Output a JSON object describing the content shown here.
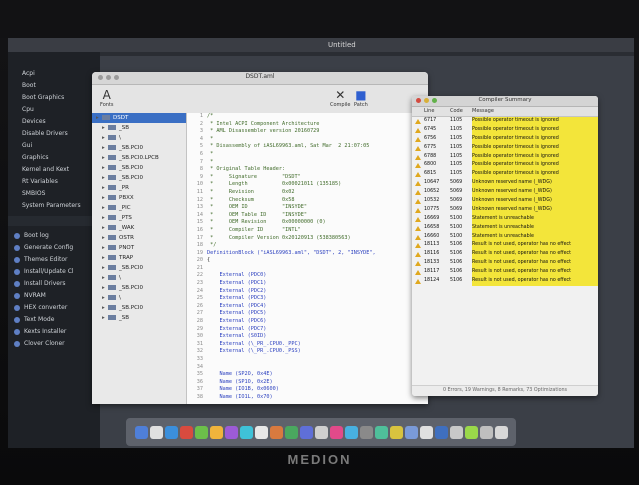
{
  "menubar": {
    "title": "Untitled"
  },
  "sidebar": {
    "items": [
      "Acpi",
      "Boot",
      "Boot Graphics",
      "Cpu",
      "Devices",
      "Disable Drivers",
      "Gui",
      "Graphics",
      "Kernel and Kext",
      "Rt Variables",
      "SMBIOS",
      "System Parameters"
    ],
    "tools": [
      "Boot log",
      "Generate Config",
      "Themes Editor",
      "Install/Update Cl",
      "Install Drivers",
      "NVRAM",
      "HEX converter",
      "Text Mode",
      "Kexts Installer",
      "Clover Cloner"
    ]
  },
  "main_window": {
    "title": "DSDT.aml",
    "toolbar": {
      "fonts_label": "Fonts",
      "compile_label": "Compile",
      "patch_label": "Patch"
    },
    "tree": [
      {
        "label": "DSDT",
        "selected": true
      },
      {
        "label": "_SB"
      },
      {
        "label": "\\"
      },
      {
        "label": "_SB.PCI0"
      },
      {
        "label": "_SB.PCI0.LPCB"
      },
      {
        "label": "_SB.PCI0"
      },
      {
        "label": "_SB.PCI0"
      },
      {
        "label": "_PR"
      },
      {
        "label": "PBXX"
      },
      {
        "label": "_PIC"
      },
      {
        "label": "_PTS"
      },
      {
        "label": "_WAK"
      },
      {
        "label": "OSTR"
      },
      {
        "label": "PNOT"
      },
      {
        "label": "TRAP"
      },
      {
        "label": "_SB.PCI0"
      },
      {
        "label": "\\"
      },
      {
        "label": "_SB.PCI0"
      },
      {
        "label": "\\"
      },
      {
        "label": "_SB.PCI0"
      },
      {
        "label": "_SB"
      }
    ],
    "code": [
      {
        "n": "1",
        "t": "/*"
      },
      {
        "n": "2",
        "t": " * Intel ACPI Component Architecture"
      },
      {
        "n": "3",
        "t": " * AML Disassembler version 20160729"
      },
      {
        "n": "4",
        "t": " *"
      },
      {
        "n": "5",
        "t": " * Disassembly of iASL69963.aml, Sat Mar  2 21:07:05"
      },
      {
        "n": "6",
        "t": " *"
      },
      {
        "n": "7",
        "t": " *"
      },
      {
        "n": "8",
        "t": " * Original Table Header:"
      },
      {
        "n": "9",
        "t": " *     Signature        \"DSDT\""
      },
      {
        "n": "10",
        "t": " *     Length           0x00021011 (135185)"
      },
      {
        "n": "11",
        "t": " *     Revision         0x02"
      },
      {
        "n": "12",
        "t": " *     Checksum         0x58"
      },
      {
        "n": "13",
        "t": " *     OEM ID           \"INSYDE\""
      },
      {
        "n": "14",
        "t": " *     OEM Table ID     \"INSYDE\""
      },
      {
        "n": "15",
        "t": " *     OEM Revision     0x00000000 (0)"
      },
      {
        "n": "16",
        "t": " *     Compiler ID      \"INTL\""
      },
      {
        "n": "17",
        "t": " *     Compiler Version 0x20120913 (538380563)"
      },
      {
        "n": "18",
        "t": " */"
      },
      {
        "n": "19",
        "t": "DefinitionBlock (\"iASL69963.aml\", \"DSDT\", 2, \"INSYDE\","
      },
      {
        "n": "20",
        "t": "{"
      },
      {
        "n": "21",
        "t": ""
      },
      {
        "n": "22",
        "t": "    External (PDC0)"
      },
      {
        "n": "23",
        "t": "    External (PDC1)"
      },
      {
        "n": "24",
        "t": "    External (PDC2)"
      },
      {
        "n": "25",
        "t": "    External (PDC3)"
      },
      {
        "n": "26",
        "t": "    External (PDC4)"
      },
      {
        "n": "27",
        "t": "    External (PDC5)"
      },
      {
        "n": "28",
        "t": "    External (PDC6)"
      },
      {
        "n": "29",
        "t": "    External (PDC7)"
      },
      {
        "n": "30",
        "t": "    External (S0ID)"
      },
      {
        "n": "31",
        "t": "    External (\\_PR_.CPU0._PPC)"
      },
      {
        "n": "32",
        "t": "    External (\\_PR_.CPU0._PSS)"
      },
      {
        "n": "33",
        "t": ""
      },
      {
        "n": "34",
        "t": ""
      },
      {
        "n": "35",
        "t": "    Name (SP2O, 0x4E)"
      },
      {
        "n": "36",
        "t": "    Name (SP1O, 0x2E)"
      },
      {
        "n": "37",
        "t": "    Name (IO1B, 0x0600)"
      },
      {
        "n": "38",
        "t": "    Name (IO1L, 0x70)"
      }
    ]
  },
  "compiler": {
    "title": "Compiler Summary",
    "headers": {
      "line": "Line",
      "code": "Code",
      "message": "Message"
    },
    "rows": [
      {
        "line": "6717",
        "code": "1105",
        "msg": "Possible operator timeout is ignored",
        "type": "warning"
      },
      {
        "line": "6745",
        "code": "1105",
        "msg": "Possible operator timeout is ignored",
        "type": "warning"
      },
      {
        "line": "6756",
        "code": "1105",
        "msg": "Possible operator timeout is ignored",
        "type": "warning"
      },
      {
        "line": "6775",
        "code": "1105",
        "msg": "Possible operator timeout is ignored",
        "type": "warning"
      },
      {
        "line": "6788",
        "code": "1105",
        "msg": "Possible operator timeout is ignored",
        "type": "warning"
      },
      {
        "line": "6800",
        "code": "1105",
        "msg": "Possible operator timeout is ignored",
        "type": "warning"
      },
      {
        "line": "6815",
        "code": "1105",
        "msg": "Possible operator timeout is ignored",
        "type": "warning"
      },
      {
        "line": "10647",
        "code": "5069",
        "msg": "Unknown reserved name (_WDG)",
        "type": "warning"
      },
      {
        "line": "10652",
        "code": "5069",
        "msg": "Unknown reserved name (_WDG)",
        "type": "warning"
      },
      {
        "line": "10532",
        "code": "5069",
        "msg": "Unknown reserved name (_WDG)",
        "type": "warning"
      },
      {
        "line": "10775",
        "code": "5069",
        "msg": "Unknown reserved name (_WDG)",
        "type": "warning"
      },
      {
        "line": "16669",
        "code": "5100",
        "msg": "Statement is unreachable",
        "type": "warning"
      },
      {
        "line": "16658",
        "code": "5100",
        "msg": "Statement is unreachable",
        "type": "warning"
      },
      {
        "line": "16660",
        "code": "5100",
        "msg": "Statement is unreachable",
        "type": "warning"
      },
      {
        "line": "18113",
        "code": "5106",
        "msg": "Result is not used, operator has no effect",
        "type": "warning"
      },
      {
        "line": "18116",
        "code": "5106",
        "msg": "Result is not used, operator has no effect",
        "type": "warning"
      },
      {
        "line": "18133",
        "code": "5106",
        "msg": "Result is not used, operator has no effect",
        "type": "warning"
      },
      {
        "line": "18117",
        "code": "5106",
        "msg": "Result is not used, operator has no effect",
        "type": "warning"
      },
      {
        "line": "18124",
        "code": "5106",
        "msg": "Result is not used, operator has no effect",
        "type": "warning"
      }
    ],
    "status": "0 Errors, 19 Warnings, 8 Remarks, 73 Optimizations"
  },
  "brand": "MEDION",
  "colors": {
    "highlight": "#f3e53a",
    "warning": "#e0a81e",
    "selection": "#3a6fc4"
  }
}
